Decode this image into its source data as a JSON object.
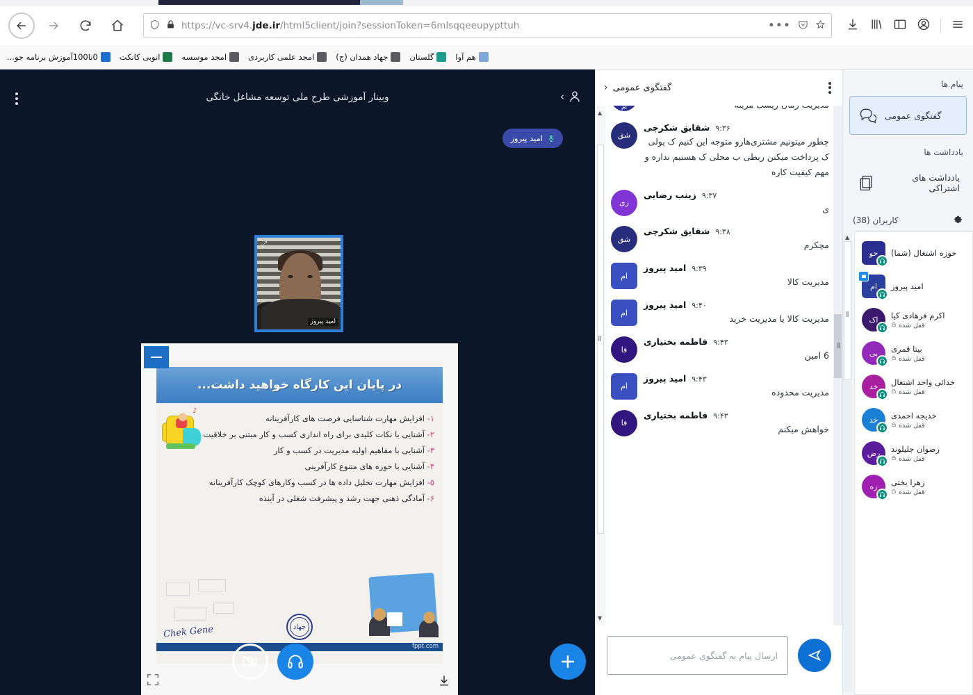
{
  "browser": {
    "url_prefix": "https://vc-srv4.",
    "url_domain": "jde.ir",
    "url_suffix": "/html5client/join?sessionToken=6mlsqqeeupypttuh",
    "back_icon": "back-arrow-icon",
    "forward_icon": "forward-arrow-icon",
    "reload_icon": "reload-icon",
    "home_icon": "home-icon",
    "shield_icon": "shield-icon",
    "lock_icon": "lock-icon",
    "page_actions_icon": "ellipsis-icon",
    "pocket_icon": "pocket-icon",
    "bookmark_star_icon": "star-icon",
    "download_icon": "download-icon",
    "library_icon": "library-icon",
    "sidebar_icon": "sidebar-icon",
    "account_icon": "account-icon",
    "menu_icon": "hamburger-menu-icon",
    "bookmarks": [
      {
        "label": "0تا100آموزش برنامه جو...",
        "color": "#1f6fd0"
      },
      {
        "label": "انوبی کانکت",
        "color": "#1d7a4a"
      },
      {
        "label": "امجد موسسه",
        "color": "#5a5a5f"
      },
      {
        "label": "امجد علمی کاربردی",
        "color": "#5a5a5f"
      },
      {
        "label": "جهاد همدان (ج)",
        "color": "#5a5a5f"
      },
      {
        "label": "گلستان",
        "color": "#1d9c8e"
      },
      {
        "label": "هم آوا",
        "color": "#7fa8d8"
      }
    ]
  },
  "stage": {
    "title": "وبینار آموزشی طرح ملی توسعه مشاغل خانگی",
    "options_icon": "kebab-menu-icon",
    "users_toggle_icon": "user-panel-icon",
    "talking_user": "امید پیروز",
    "microphone_icon": "microphone-icon",
    "webcam": {
      "label": "امید پیروز",
      "expand_icon": "expand-icon"
    },
    "slide": {
      "title": "در پایان این کارگاه خواهید داشت...",
      "bullets": [
        {
          "num": "۱-",
          "text": "افزایش مهارت شناسایی فرصت های کارآفرینانه"
        },
        {
          "num": "۲-",
          "text": "آشنایی با نکات کلیدی برای راه اندازی کسب و کار مبتنی بر خلاقیت"
        },
        {
          "num": "۳-",
          "text": "آشنایی با مفاهیم اولیه مدیریت در کسب و کار"
        },
        {
          "num": "۴-",
          "text": "آشنایی با حوزه های متنوع کارآفرینی"
        },
        {
          "num": "۵-",
          "text": "افزایش مهارت تحلیل داده ها در کسب وکارهای کوچک کارآفرینانه"
        },
        {
          "num": "۶-",
          "text": "آمادگی ذهنی جهت رشد و پیشرفت شغلی در آینده"
        }
      ],
      "signature": "Chek Gene",
      "seal_text": "جهاد",
      "watermark": "fppt.com",
      "minimize_icon": "minimize-icon",
      "fullscreen_icon": "fullscreen-icon",
      "download_icon": "download-icon"
    },
    "controls": [
      {
        "name": "video-button",
        "icon": "camera-off-icon",
        "style": "outline"
      },
      {
        "name": "audio-button",
        "icon": "headphones-icon",
        "style": "blue"
      },
      {
        "name": "actions-button",
        "icon": "plus-icon",
        "style": "plus"
      }
    ]
  },
  "chat": {
    "title": "گفتگوی عمومی",
    "back_icon": "chevron-left-icon",
    "options_icon": "kebab-menu-icon",
    "input_placeholder": "ارسال پیام به گفتگوی عمومی",
    "input_value": "",
    "send_icon": "send-icon",
    "messages": [
      {
        "name": "",
        "time": "",
        "text": "مدیریت زمان ریسک هزینه",
        "initials": "ام",
        "color": "#2b2f90",
        "shape": "circle",
        "continued": true
      },
      {
        "name": "شقایق شکرچی",
        "time": "۹:۳۶",
        "text": "چطور میتونیم مشتری‌هارو متوجه این کنیم ک پولی ک پرداخت میکنن ربطی ب محلی ک هستیم نداره و مهم کیفیت کاره",
        "initials": "شق",
        "color": "#272d7a",
        "shape": "circle",
        "continued": false
      },
      {
        "name": "زینب رضایی",
        "time": "۹:۳۷",
        "text": "ی",
        "initials": "زی",
        "color": "#8135d4",
        "shape": "circle",
        "continued": false
      },
      {
        "name": "شقایق شکرچی",
        "time": "۹:۳۸",
        "text": "مچکرم",
        "initials": "شق",
        "color": "#272d7a",
        "shape": "circle",
        "continued": false
      },
      {
        "name": "امید پیروز",
        "time": "۹:۳۹",
        "text": "مدیریت کالا",
        "initials": "ام",
        "color": "#3a4fc0",
        "shape": "square",
        "continued": false
      },
      {
        "name": "امید پیروز",
        "time": "۹:۴۰",
        "text": "مدیریت کالا یا مدیریت خرید",
        "initials": "ام",
        "color": "#3a4fc0",
        "shape": "square",
        "continued": false
      },
      {
        "name": "فاطمه بختیاری",
        "time": "۹:۴۳",
        "text": "6 امین",
        "initials": "فا",
        "color": "#32157e",
        "shape": "circle",
        "continued": false
      },
      {
        "name": "امید پیروز",
        "time": "۹:۴۳",
        "text": "مدیریت محدوده",
        "initials": "ام",
        "color": "#3a4fc0",
        "shape": "square",
        "continued": false
      },
      {
        "name": "فاطمه بختیاری",
        "time": "۹:۴۳",
        "text": "خواهش میکنم",
        "initials": "فا",
        "color": "#32157e",
        "shape": "circle",
        "continued": false
      }
    ]
  },
  "navpanel": {
    "messages_label": "پیام ها",
    "public_chat_label": "گفتگوی عمومی",
    "public_chat_icon": "chat-bubble-icon",
    "notes_label": "یادداشت ها",
    "shared_notes_label": "یادداشت های اشتراکی",
    "shared_notes_icon": "notes-icon",
    "users_label": "کاربران (38)",
    "users_settings_icon": "gear-icon",
    "users": [
      {
        "name": "حوزه اشتغال (شما)",
        "status": "",
        "initials": "حو",
        "color": "#2b2f90",
        "shape": "square",
        "presenter": false,
        "muted": false
      },
      {
        "name": "امید پیروز",
        "status": "",
        "initials": "ام",
        "color": "#2b3f9e",
        "shape": "square",
        "presenter": true,
        "muted": false
      },
      {
        "name": "اکرم فرهادی کیا",
        "status": "قفل شده",
        "initials": "اک",
        "color": "#3b1a6e",
        "shape": "circle",
        "presenter": false,
        "muted": true
      },
      {
        "name": "بیتا قمری",
        "status": "قفل شده",
        "initials": "بی",
        "color": "#9229b8",
        "shape": "circle",
        "presenter": false,
        "muted": true
      },
      {
        "name": "خدائی واحد اشتغال",
        "status": "قفل شده",
        "initials": "خد",
        "color": "#a81fa0",
        "shape": "circle",
        "presenter": false,
        "muted": true
      },
      {
        "name": "خدیجه احمدی",
        "status": "قفل شده",
        "initials": "خد",
        "color": "#1b7fd4",
        "shape": "circle",
        "presenter": false,
        "muted": true
      },
      {
        "name": "رضوان جلیلوند",
        "status": "قفل شده",
        "initials": "رض",
        "color": "#5b1d9c",
        "shape": "circle",
        "presenter": false,
        "muted": true
      },
      {
        "name": "زهرا بختی",
        "status": "قفل شده",
        "initials": "زه",
        "color": "#9e1fb0",
        "shape": "circle",
        "presenter": false,
        "muted": true
      }
    ]
  },
  "colors": {
    "accent_blue": "#1b84e7",
    "stage_bg": "#0b1729",
    "panel_bg": "#f3f5f9",
    "presenter_blue": "#3a4fc0"
  }
}
